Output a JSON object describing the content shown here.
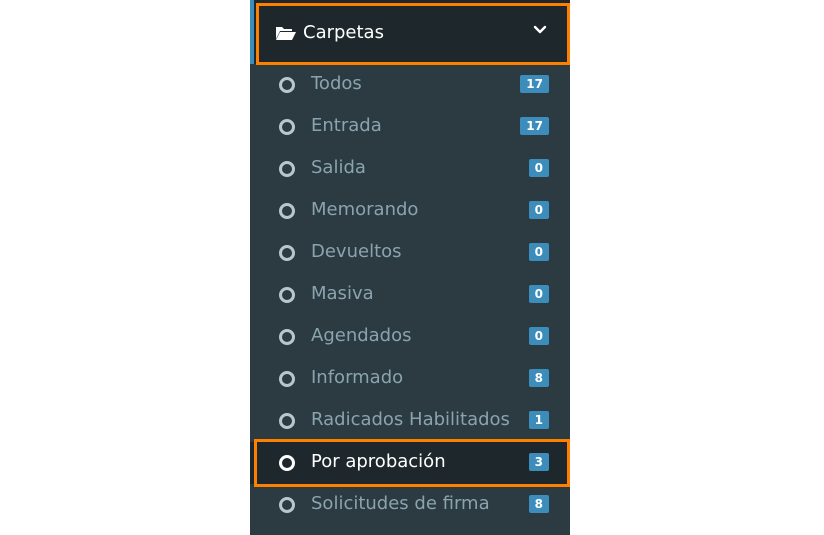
{
  "header": {
    "title": "Carpetas",
    "icon": "folder-open-icon",
    "chevron": "chevron-down-icon"
  },
  "items": [
    {
      "label": "Todos",
      "count": "17"
    },
    {
      "label": "Entrada",
      "count": "17"
    },
    {
      "label": "Salida",
      "count": "0"
    },
    {
      "label": "Memorando",
      "count": "0"
    },
    {
      "label": "Devueltos",
      "count": "0"
    },
    {
      "label": "Masiva",
      "count": "0"
    },
    {
      "label": "Agendados",
      "count": "0"
    },
    {
      "label": "Informado",
      "count": "8"
    },
    {
      "label": "Radicados Habilitados",
      "count": "1"
    },
    {
      "label": "Por aprobación",
      "count": "3"
    },
    {
      "label": "Solicitudes de firma",
      "count": "8"
    }
  ],
  "colors": {
    "sidebar_bg": "#2c3b41",
    "header_bg": "#1e282c",
    "badge_bg": "#3c8dbc",
    "highlight": "#ff7f00"
  }
}
